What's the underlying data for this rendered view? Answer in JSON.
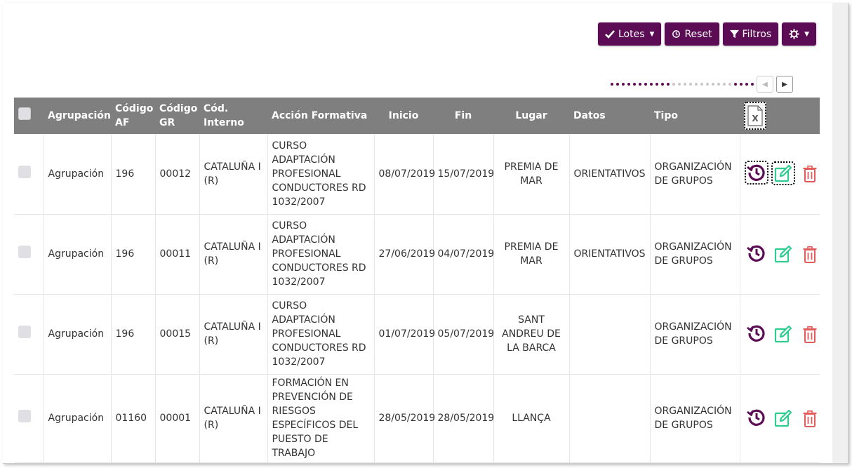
{
  "toolbar": {
    "lotes_label": "Lotes",
    "reset_label": "Reset",
    "filtros_label": "Filtros"
  },
  "colors": {
    "primary": "#5c0c55",
    "header_bg": "#7f7f7f",
    "edit_green": "#2ecc8f",
    "delete_red": "#e35b5b"
  },
  "table": {
    "headers": {
      "agrupacion": "Agrupación",
      "codigo_af_1": "Código",
      "codigo_af_2": "AF",
      "codigo_gr_1": "Código",
      "codigo_gr_2": "GR",
      "cod_interno_1": "Cód.",
      "cod_interno_2": "Interno",
      "accion": "Acción Formativa",
      "inicio": "Inicio",
      "fin": "Fin",
      "lugar": "Lugar",
      "datos": "Datos",
      "tipo": "Tipo"
    },
    "rows": [
      {
        "agrupacion": "Agrupación",
        "codigo_af": "196",
        "codigo_gr": "00012",
        "cod_interno": "CATALUÑA I (R)",
        "accion": "CURSO ADAPTACIÓN PROFESIONAL CONDUCTORES RD 1032/2007",
        "inicio": "08/07/2019",
        "fin": "15/07/2019",
        "lugar": "PREMIA DE MAR",
        "datos": "ORIENTATIVOS",
        "tipo": "ORGANIZACIÓN DE GRUPOS"
      },
      {
        "agrupacion": "Agrupación",
        "codigo_af": "196",
        "codigo_gr": "00011",
        "cod_interno": "CATALUÑA I (R)",
        "accion": "CURSO ADAPTACIÓN PROFESIONAL CONDUCTORES RD 1032/2007",
        "inicio": "27/06/2019",
        "fin": "04/07/2019",
        "lugar": "PREMIA DE MAR",
        "datos": "ORIENTATIVOS",
        "tipo": "ORGANIZACIÓN DE GRUPOS"
      },
      {
        "agrupacion": "Agrupación",
        "codigo_af": "196",
        "codigo_gr": "00015",
        "cod_interno": "CATALUÑA I (R)",
        "accion": "CURSO ADAPTACIÓN PROFESIONAL CONDUCTORES RD 1032/2007",
        "inicio": "01/07/2019",
        "fin": "05/07/2019",
        "lugar": "SANT ANDREU DE LA BARCA",
        "datos": "",
        "tipo": "ORGANIZACIÓN DE GRUPOS"
      },
      {
        "agrupacion": "Agrupación",
        "codigo_af": "01160",
        "codigo_gr": "00001",
        "cod_interno": "CATALUÑA I (R)",
        "accion": "FORMACIÓN EN PREVENCIÓN DE RIESGOS ESPECÍFICOS DEL PUESTO DE TRABAJO",
        "inicio": "28/05/2019",
        "fin": "28/05/2019",
        "lugar": "LLANÇA",
        "datos": "",
        "tipo": "ORGANIZACIÓN DE GRUPOS"
      }
    ]
  },
  "icons": {
    "check": "check-icon",
    "reset": "history-icon",
    "filter": "filter-icon",
    "settings": "gear-icon",
    "excel": "excel-export-icon",
    "history": "history-icon",
    "edit": "edit-icon",
    "delete": "trash-icon"
  }
}
